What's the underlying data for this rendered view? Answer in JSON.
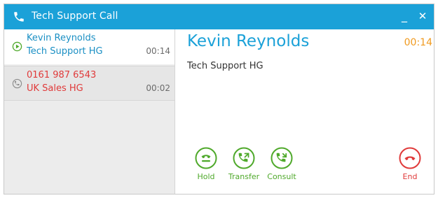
{
  "window": {
    "title": "Tech Support Call",
    "minimize_label": "_",
    "close_label": "✕"
  },
  "calls": [
    {
      "name": "Kevin Reynolds",
      "group": "Tech Support HG",
      "duration": "00:14",
      "state": "active"
    },
    {
      "name": "0161 987 6543",
      "group": "UK Sales HG",
      "duration": "00:02",
      "state": "on-hold"
    }
  ],
  "current_call": {
    "name": "Kevin Reynolds",
    "timer": "00:14",
    "group": "Tech Support HG"
  },
  "actions": {
    "hold": "Hold",
    "transfer": "Transfer",
    "consult": "Consult",
    "end": "End"
  },
  "colors": {
    "titlebar": "#1ba1d8",
    "accent_green": "#4fa92b",
    "accent_red": "#e03a3a",
    "timer_orange": "#f09a1f"
  },
  "icons": {
    "title": "phone-icon",
    "active_call": "play-circle-icon",
    "held_call": "phone-hold-icon",
    "hold": "hold-icon",
    "transfer": "phone-transfer-icon",
    "consult": "phone-consult-icon",
    "end": "phone-end-icon"
  }
}
